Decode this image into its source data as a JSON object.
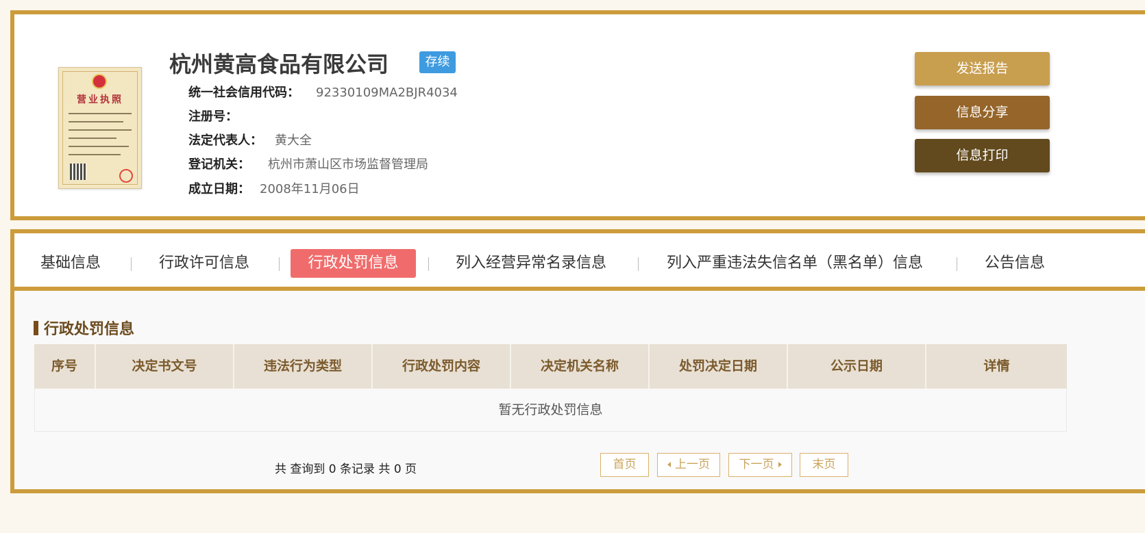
{
  "company": {
    "name": "杭州黄高食品有限公司",
    "status": "存续",
    "fields": [
      {
        "label": "统一社会信用代码：",
        "value": "92330109MA2BJR4034"
      },
      {
        "label": "注册号：",
        "value": ""
      },
      {
        "label": "法定代表人：",
        "value": "黄大全"
      },
      {
        "label": "登记机关：",
        "value": "杭州市萧山区市场监督管理局"
      },
      {
        "label": "成立日期：",
        "value": "2008年11月06日"
      }
    ],
    "license_image": {
      "title": "营业执照",
      "icon": "business-license-image"
    }
  },
  "actions": {
    "send_report": "发送报告",
    "share": "信息分享",
    "print": "信息打印"
  },
  "tabs": [
    {
      "label": "基础信息"
    },
    {
      "label": "行政许可信息"
    },
    {
      "label": "行政处罚信息"
    },
    {
      "label": "列入经营异常名录信息"
    },
    {
      "label": "列入严重违法失信名单（黑名单）信息"
    },
    {
      "label": "公告信息"
    }
  ],
  "active_tab": "行政处罚信息",
  "section": {
    "title": "行政处罚信息",
    "columns": [
      "序号",
      "决定书文号",
      "违法行为类型",
      "行政处罚内容",
      "决定机关名称",
      "处罚决定日期",
      "公示日期",
      "详情"
    ],
    "empty_message": "暂无行政处罚信息"
  },
  "pager": {
    "summary": "共 查询到 0 条记录 共 0 页",
    "first": "首页",
    "prev": "上一页",
    "next": "下一页",
    "last": "末页"
  },
  "colors": {
    "frame": "#cc9c3c",
    "status_badge": "#3e9be0",
    "active_tab": "#f06c6c",
    "btn_report": "#c89e4f",
    "btn_share": "#95652a",
    "btn_print": "#624a1e"
  }
}
